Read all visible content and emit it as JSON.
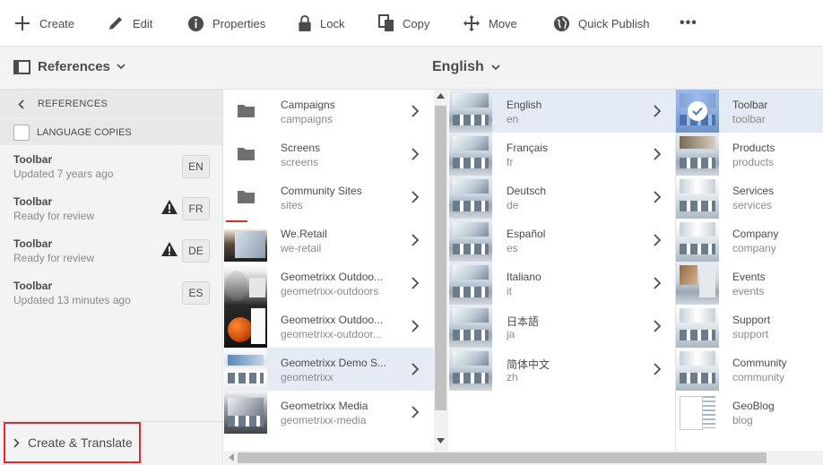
{
  "toolbar": {
    "create": "Create",
    "edit": "Edit",
    "properties": "Properties",
    "lock": "Lock",
    "copy": "Copy",
    "move": "Move",
    "quick_publish": "Quick Publish",
    "more": "•••"
  },
  "subbar": {
    "rail_label": "References",
    "language": "English"
  },
  "rail": {
    "back_label": "REFERENCES",
    "language_copies_label": "LANGUAGE COPIES",
    "copies": [
      {
        "title": "Toolbar",
        "status": "Updated 7 years ago",
        "lang": "EN",
        "warning": false
      },
      {
        "title": "Toolbar",
        "status": "Ready for review",
        "lang": "FR",
        "warning": true
      },
      {
        "title": "Toolbar",
        "status": "Ready for review",
        "lang": "DE",
        "warning": true
      },
      {
        "title": "Toolbar",
        "status": "Updated 13 minutes ago",
        "lang": "ES",
        "warning": false
      }
    ],
    "create_translate": "Create & Translate"
  },
  "columns": {
    "col1": [
      {
        "title": "Campaigns",
        "name": "campaigns",
        "thumb": "folder-icon"
      },
      {
        "title": "Screens",
        "name": "screens",
        "thumb": "folder-icon"
      },
      {
        "title": "Community Sites",
        "name": "sites",
        "thumb": "folder-icon"
      },
      {
        "title": "We.Retail",
        "name": "we-retail",
        "thumb": "retail"
      },
      {
        "title": "Geometrixx Outdoo...",
        "name": "geometrixx-outdoors",
        "thumb": "outdoor"
      },
      {
        "title": "Geometrixx Outdoo...",
        "name": "geometrixx-outdoor...",
        "thumb": "ball"
      },
      {
        "title": "Geometrixx Demo S...",
        "name": "geometrixx",
        "thumb": "demo",
        "selected": true
      },
      {
        "title": "Geometrixx Media",
        "name": "geometrixx-media",
        "thumb": "media"
      }
    ],
    "col2": [
      {
        "title": "English",
        "name": "en",
        "selected": true
      },
      {
        "title": "Français",
        "name": "fr"
      },
      {
        "title": "Deutsch",
        "name": "de"
      },
      {
        "title": "Español",
        "name": "es"
      },
      {
        "title": "Italiano",
        "name": "it"
      },
      {
        "title": "日本語",
        "name": "ja"
      },
      {
        "title": "简体中文",
        "name": "zh"
      }
    ],
    "col3": [
      {
        "title": "Toolbar",
        "name": "toolbar",
        "selected": true,
        "thumb": "bright"
      },
      {
        "title": "Products",
        "name": "products",
        "thumb": "products"
      },
      {
        "title": "Services",
        "name": "services",
        "thumb": "bright"
      },
      {
        "title": "Company",
        "name": "company",
        "thumb": "bright"
      },
      {
        "title": "Events",
        "name": "events",
        "thumb": "events"
      },
      {
        "title": "Support",
        "name": "support",
        "thumb": "bright"
      },
      {
        "title": "Community",
        "name": "community",
        "thumb": "bright"
      },
      {
        "title": "GeoBlog",
        "name": "blog",
        "thumb": "geoblog"
      }
    ]
  },
  "colors": {
    "accent": "#2680eb",
    "selected_row": "#e4ebf5",
    "highlight_border": "#e0282d"
  }
}
